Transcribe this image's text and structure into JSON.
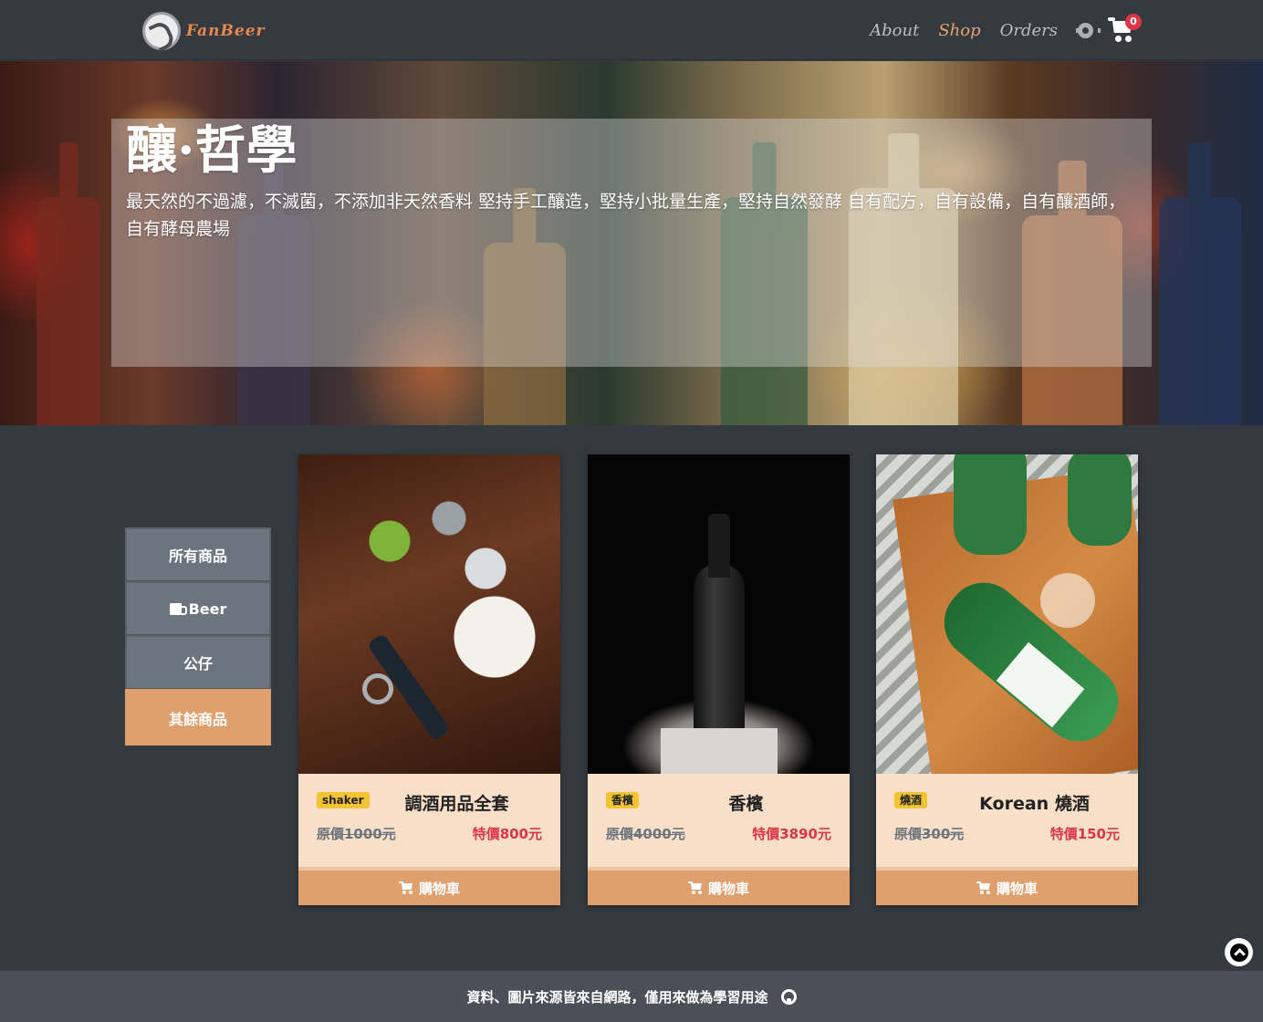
{
  "brand": {
    "logo_text": "FanBeer"
  },
  "nav": {
    "links": [
      {
        "label": "About",
        "active": false
      },
      {
        "label": "Shop",
        "active": true
      },
      {
        "label": "Orders",
        "active": false
      }
    ],
    "settings_icon": "gear-icon",
    "cart_icon": "cart-icon",
    "cart_count": "0"
  },
  "hero": {
    "title": "釀·哲學",
    "description": "最天然的不過濾，不滅菌，不添加非天然香料 堅持手工釀造，堅持小批量生產，堅持自然發酵 自有配方，自有設備，自有釀酒師，自有酵母農場"
  },
  "sidebar": {
    "items": [
      {
        "label": "所有商品",
        "icon": "",
        "active": false
      },
      {
        "label": "Beer",
        "icon": "beer-mug-icon",
        "active": false
      },
      {
        "label": "公仔",
        "icon": "",
        "active": false
      },
      {
        "label": "其餘商品",
        "icon": "",
        "active": true
      }
    ]
  },
  "products": [
    {
      "tag": "shaker",
      "title": "調酒用品全套",
      "original_price": "原價1000元",
      "sale_price": "特價800元",
      "button_label": "購物車"
    },
    {
      "tag": "香檳",
      "title": "香檳",
      "original_price": "原價4000元",
      "sale_price": "特價3890元",
      "button_label": "購物車"
    },
    {
      "tag": "燒酒",
      "title": "Korean 燒酒",
      "original_price": "原價300元",
      "sale_price": "特價150元",
      "button_label": "購物車"
    }
  ],
  "footer": {
    "text": "資料、圖片來源皆來自網路，僅用來做為學習用途",
    "icon": "github-icon"
  },
  "colors": {
    "accent": "#e0a06e",
    "background": "#343a40",
    "sale_red": "#dc3545",
    "tag_yellow": "#f3c432",
    "card_bg": "#f7dfc8"
  }
}
